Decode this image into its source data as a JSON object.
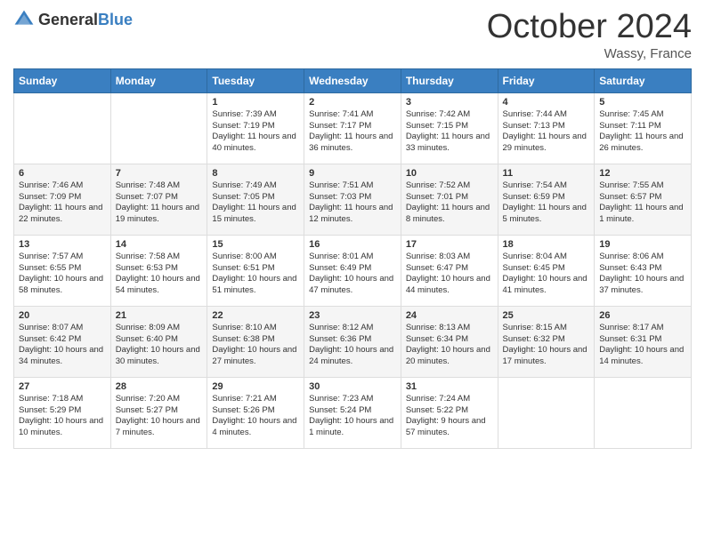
{
  "logo": {
    "general": "General",
    "blue": "Blue"
  },
  "header": {
    "month": "October 2024",
    "location": "Wassy, France"
  },
  "weekdays": [
    "Sunday",
    "Monday",
    "Tuesday",
    "Wednesday",
    "Thursday",
    "Friday",
    "Saturday"
  ],
  "weeks": [
    [
      {
        "day": "",
        "sunrise": "",
        "sunset": "",
        "daylight": ""
      },
      {
        "day": "",
        "sunrise": "",
        "sunset": "",
        "daylight": ""
      },
      {
        "day": "1",
        "sunrise": "Sunrise: 7:39 AM",
        "sunset": "Sunset: 7:19 PM",
        "daylight": "Daylight: 11 hours and 40 minutes."
      },
      {
        "day": "2",
        "sunrise": "Sunrise: 7:41 AM",
        "sunset": "Sunset: 7:17 PM",
        "daylight": "Daylight: 11 hours and 36 minutes."
      },
      {
        "day": "3",
        "sunrise": "Sunrise: 7:42 AM",
        "sunset": "Sunset: 7:15 PM",
        "daylight": "Daylight: 11 hours and 33 minutes."
      },
      {
        "day": "4",
        "sunrise": "Sunrise: 7:44 AM",
        "sunset": "Sunset: 7:13 PM",
        "daylight": "Daylight: 11 hours and 29 minutes."
      },
      {
        "day": "5",
        "sunrise": "Sunrise: 7:45 AM",
        "sunset": "Sunset: 7:11 PM",
        "daylight": "Daylight: 11 hours and 26 minutes."
      }
    ],
    [
      {
        "day": "6",
        "sunrise": "Sunrise: 7:46 AM",
        "sunset": "Sunset: 7:09 PM",
        "daylight": "Daylight: 11 hours and 22 minutes."
      },
      {
        "day": "7",
        "sunrise": "Sunrise: 7:48 AM",
        "sunset": "Sunset: 7:07 PM",
        "daylight": "Daylight: 11 hours and 19 minutes."
      },
      {
        "day": "8",
        "sunrise": "Sunrise: 7:49 AM",
        "sunset": "Sunset: 7:05 PM",
        "daylight": "Daylight: 11 hours and 15 minutes."
      },
      {
        "day": "9",
        "sunrise": "Sunrise: 7:51 AM",
        "sunset": "Sunset: 7:03 PM",
        "daylight": "Daylight: 11 hours and 12 minutes."
      },
      {
        "day": "10",
        "sunrise": "Sunrise: 7:52 AM",
        "sunset": "Sunset: 7:01 PM",
        "daylight": "Daylight: 11 hours and 8 minutes."
      },
      {
        "day": "11",
        "sunrise": "Sunrise: 7:54 AM",
        "sunset": "Sunset: 6:59 PM",
        "daylight": "Daylight: 11 hours and 5 minutes."
      },
      {
        "day": "12",
        "sunrise": "Sunrise: 7:55 AM",
        "sunset": "Sunset: 6:57 PM",
        "daylight": "Daylight: 11 hours and 1 minute."
      }
    ],
    [
      {
        "day": "13",
        "sunrise": "Sunrise: 7:57 AM",
        "sunset": "Sunset: 6:55 PM",
        "daylight": "Daylight: 10 hours and 58 minutes."
      },
      {
        "day": "14",
        "sunrise": "Sunrise: 7:58 AM",
        "sunset": "Sunset: 6:53 PM",
        "daylight": "Daylight: 10 hours and 54 minutes."
      },
      {
        "day": "15",
        "sunrise": "Sunrise: 8:00 AM",
        "sunset": "Sunset: 6:51 PM",
        "daylight": "Daylight: 10 hours and 51 minutes."
      },
      {
        "day": "16",
        "sunrise": "Sunrise: 8:01 AM",
        "sunset": "Sunset: 6:49 PM",
        "daylight": "Daylight: 10 hours and 47 minutes."
      },
      {
        "day": "17",
        "sunrise": "Sunrise: 8:03 AM",
        "sunset": "Sunset: 6:47 PM",
        "daylight": "Daylight: 10 hours and 44 minutes."
      },
      {
        "day": "18",
        "sunrise": "Sunrise: 8:04 AM",
        "sunset": "Sunset: 6:45 PM",
        "daylight": "Daylight: 10 hours and 41 minutes."
      },
      {
        "day": "19",
        "sunrise": "Sunrise: 8:06 AM",
        "sunset": "Sunset: 6:43 PM",
        "daylight": "Daylight: 10 hours and 37 minutes."
      }
    ],
    [
      {
        "day": "20",
        "sunrise": "Sunrise: 8:07 AM",
        "sunset": "Sunset: 6:42 PM",
        "daylight": "Daylight: 10 hours and 34 minutes."
      },
      {
        "day": "21",
        "sunrise": "Sunrise: 8:09 AM",
        "sunset": "Sunset: 6:40 PM",
        "daylight": "Daylight: 10 hours and 30 minutes."
      },
      {
        "day": "22",
        "sunrise": "Sunrise: 8:10 AM",
        "sunset": "Sunset: 6:38 PM",
        "daylight": "Daylight: 10 hours and 27 minutes."
      },
      {
        "day": "23",
        "sunrise": "Sunrise: 8:12 AM",
        "sunset": "Sunset: 6:36 PM",
        "daylight": "Daylight: 10 hours and 24 minutes."
      },
      {
        "day": "24",
        "sunrise": "Sunrise: 8:13 AM",
        "sunset": "Sunset: 6:34 PM",
        "daylight": "Daylight: 10 hours and 20 minutes."
      },
      {
        "day": "25",
        "sunrise": "Sunrise: 8:15 AM",
        "sunset": "Sunset: 6:32 PM",
        "daylight": "Daylight: 10 hours and 17 minutes."
      },
      {
        "day": "26",
        "sunrise": "Sunrise: 8:17 AM",
        "sunset": "Sunset: 6:31 PM",
        "daylight": "Daylight: 10 hours and 14 minutes."
      }
    ],
    [
      {
        "day": "27",
        "sunrise": "Sunrise: 7:18 AM",
        "sunset": "Sunset: 5:29 PM",
        "daylight": "Daylight: 10 hours and 10 minutes."
      },
      {
        "day": "28",
        "sunrise": "Sunrise: 7:20 AM",
        "sunset": "Sunset: 5:27 PM",
        "daylight": "Daylight: 10 hours and 7 minutes."
      },
      {
        "day": "29",
        "sunrise": "Sunrise: 7:21 AM",
        "sunset": "Sunset: 5:26 PM",
        "daylight": "Daylight: 10 hours and 4 minutes."
      },
      {
        "day": "30",
        "sunrise": "Sunrise: 7:23 AM",
        "sunset": "Sunset: 5:24 PM",
        "daylight": "Daylight: 10 hours and 1 minute."
      },
      {
        "day": "31",
        "sunrise": "Sunrise: 7:24 AM",
        "sunset": "Sunset: 5:22 PM",
        "daylight": "Daylight: 9 hours and 57 minutes."
      },
      {
        "day": "",
        "sunrise": "",
        "sunset": "",
        "daylight": ""
      },
      {
        "day": "",
        "sunrise": "",
        "sunset": "",
        "daylight": ""
      }
    ]
  ]
}
